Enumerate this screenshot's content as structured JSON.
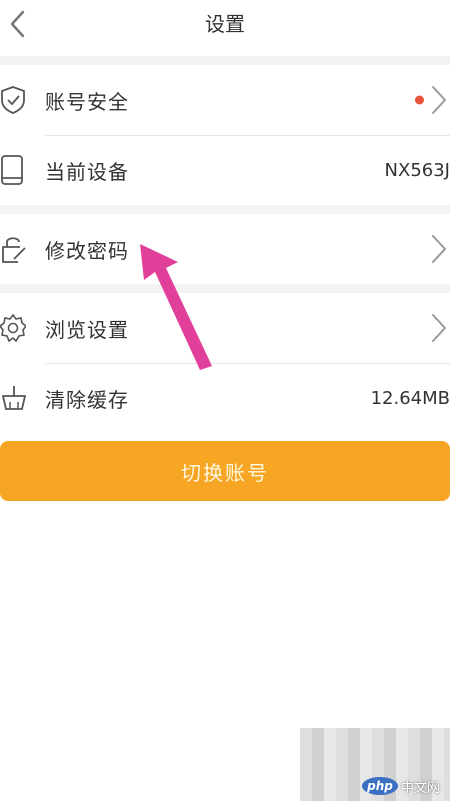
{
  "header": {
    "title": "设置",
    "back_icon": "chevron-left-icon"
  },
  "sections": [
    [
      {
        "name": "account-security",
        "label": "账号安全",
        "icon": "shield-icon",
        "value": "",
        "dot": true,
        "chevron": true
      },
      {
        "name": "current-device",
        "label": "当前设备",
        "icon": "phone-icon",
        "value": "NX563J",
        "dot": false,
        "chevron": false
      }
    ],
    [
      {
        "name": "change-password",
        "label": "修改密码",
        "icon": "lock-edit-icon",
        "value": "",
        "dot": false,
        "chevron": true
      }
    ],
    [
      {
        "name": "browse-settings",
        "label": "浏览设置",
        "icon": "gear-icon",
        "value": "",
        "dot": false,
        "chevron": true
      },
      {
        "name": "clear-cache",
        "label": "清除缓存",
        "icon": "broom-icon",
        "value": "12.64MB",
        "dot": false,
        "chevron": false
      }
    ]
  ],
  "switch_account": {
    "label": "切换账号"
  },
  "watermark": {
    "logo_text": "php",
    "site_text": "中文网"
  },
  "colors": {
    "accent": "#f6a623",
    "badge_dot": "#e8533b",
    "arrow": "#e0409a",
    "icon_stroke": "#555555",
    "chevron": "#999999"
  }
}
